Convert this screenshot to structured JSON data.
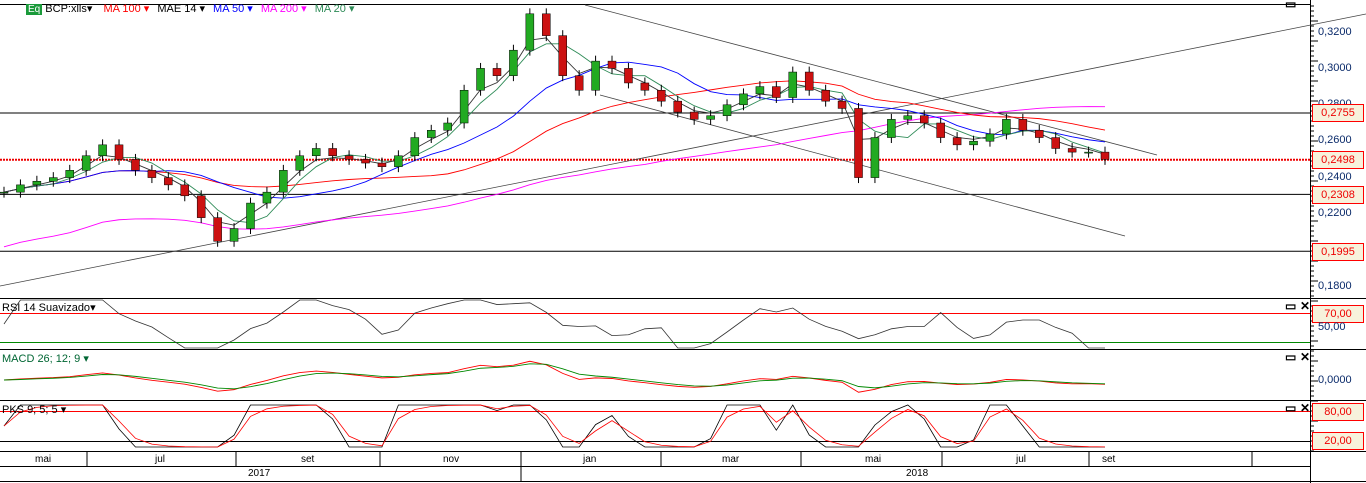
{
  "header": {
    "symbol_badge": "Eq",
    "symbol": "BCP:xlls",
    "indicators": [
      {
        "label": "MA 100",
        "color": "#ff0000"
      },
      {
        "label": "MAE 14",
        "color": "#000000"
      },
      {
        "label": "MA 50",
        "color": "#0000ff"
      },
      {
        "label": "MA 200",
        "color": "#ff00ff"
      },
      {
        "label": "MA 20",
        "color": "#2e8b57"
      }
    ]
  },
  "price_axis": {
    "ticks": [
      "0,3200",
      "0,3000",
      "0,2800",
      "0,2600",
      "0,2400",
      "0,2200",
      "0,1800"
    ],
    "levels": [
      {
        "label": "0,2755",
        "value": 0.2755
      },
      {
        "label": "0,2498",
        "value": 0.2498
      },
      {
        "label": "0,2308",
        "value": 0.2308
      },
      {
        "label": "0,1995",
        "value": 0.1995
      }
    ]
  },
  "rsi": {
    "title": "RSI 14 Suavizado",
    "upper": "70,00",
    "mid": "50,00"
  },
  "macd": {
    "title": "MACD 26; 12; 9",
    "zero": "0,0000"
  },
  "pks": {
    "title": "PKS 9; 5; 5",
    "upper": "80,00",
    "lower": "20,00"
  },
  "time_axis": {
    "months": [
      "mai",
      "jul",
      "set",
      "nov",
      "jan",
      "mar",
      "mai",
      "jul",
      "set"
    ],
    "years": [
      "2017",
      "2018"
    ]
  },
  "chart_data": {
    "type": "candlestick",
    "ylim": [
      0.17,
      0.335
    ],
    "closes": [
      0.232,
      0.236,
      0.238,
      0.24,
      0.244,
      0.252,
      0.258,
      0.25,
      0.244,
      0.24,
      0.236,
      0.23,
      0.218,
      0.205,
      0.212,
      0.226,
      0.232,
      0.244,
      0.252,
      0.256,
      0.252,
      0.25,
      0.248,
      0.246,
      0.252,
      0.262,
      0.266,
      0.27,
      0.288,
      0.3,
      0.296,
      0.31,
      0.33,
      0.318,
      0.296,
      0.288,
      0.304,
      0.3,
      0.292,
      0.288,
      0.282,
      0.276,
      0.272,
      0.274,
      0.28,
      0.286,
      0.29,
      0.284,
      0.298,
      0.288,
      0.282,
      0.278,
      0.24,
      0.262,
      0.272,
      0.274,
      0.27,
      0.262,
      0.258,
      0.26,
      0.264,
      0.272,
      0.266,
      0.262,
      0.256,
      0.254,
      0.254,
      0.25
    ]
  }
}
